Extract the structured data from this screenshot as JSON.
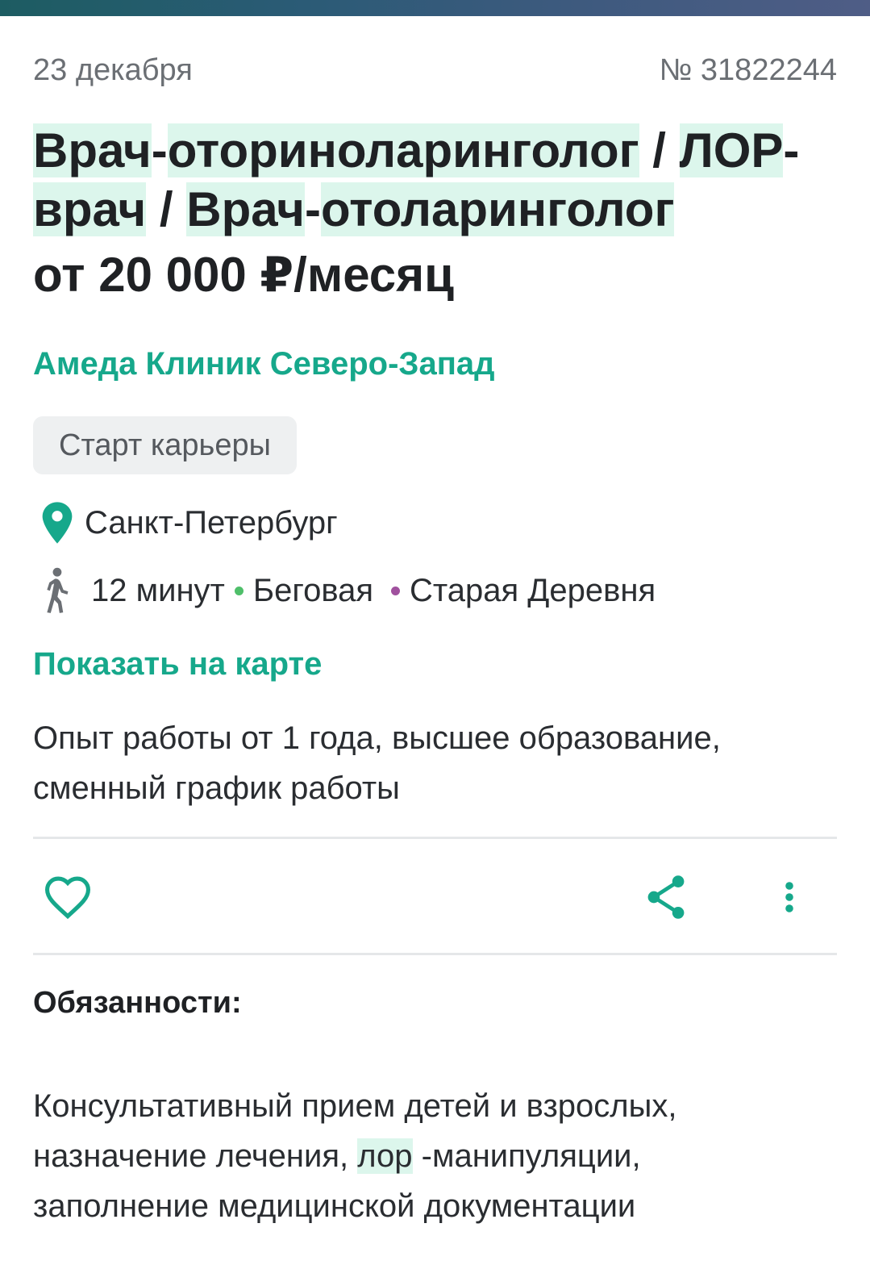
{
  "meta": {
    "date": "23 декабря",
    "number": "№ 31822244"
  },
  "vacancy": {
    "title_parts": [
      "Врач",
      "-",
      "оториноларинголог",
      " / ",
      "ЛОР",
      "-",
      "врач",
      " / ",
      "Врач",
      "-",
      "отоларинголог"
    ],
    "salary": "от 20 000 ₽/месяц",
    "company": "Амеда Клиник Северо-Запад",
    "badge": "Старт карьеры"
  },
  "location": {
    "city": "Санкт-Петербург",
    "walk_time": "12 минут",
    "stations": [
      {
        "name": "Беговая",
        "color": "#4fbf6a"
      },
      {
        "name": "Старая Деревня",
        "color": "#a0519e"
      }
    ],
    "show_on_map": "Показать на карте"
  },
  "summary": {
    "line1": "Опыт работы от 1 года, высшее образование,",
    "line2": "сменный график работы"
  },
  "actions": {
    "favorite_icon": "heart-icon",
    "share_icon": "share-icon",
    "more_icon": "more-vertical-icon"
  },
  "duties": {
    "heading": "Обязанности:",
    "line1": "Консультативный прием детей и взрослых,",
    "line2_before": "назначение лечения, ",
    "line2_highlight": "лор",
    "line2_after": " -манипуляции,",
    "line3": "заполнение медицинской документации"
  },
  "colors": {
    "accent": "#16a88b",
    "highlight": "#dcf6ec",
    "text": "#1f2124",
    "muted": "#6b6f74"
  }
}
